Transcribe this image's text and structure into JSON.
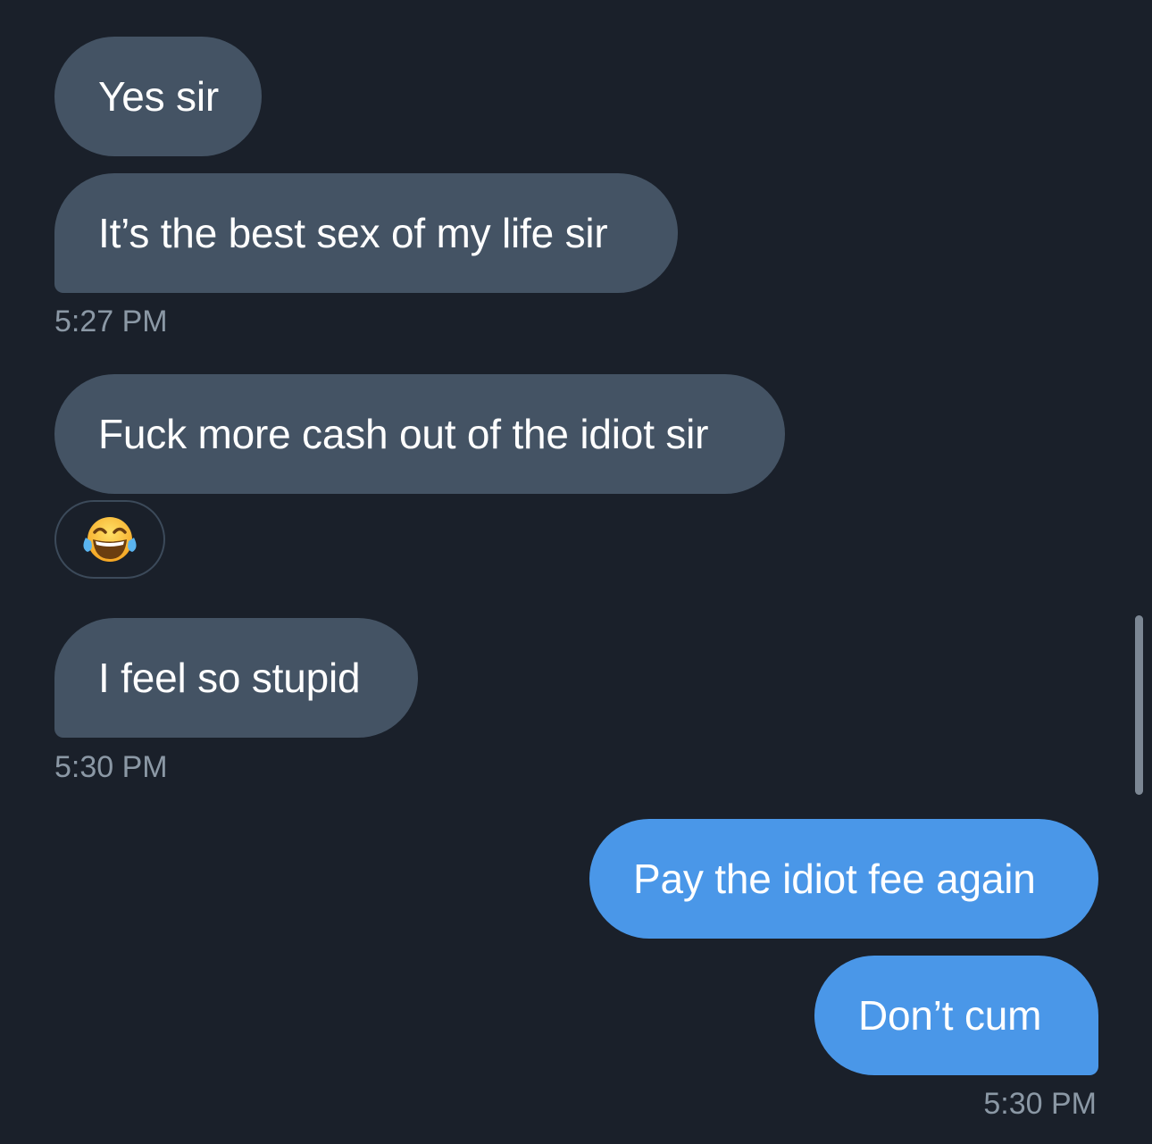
{
  "conversation": {
    "messages": [
      {
        "direction": "incoming",
        "text": "Yes sir"
      },
      {
        "direction": "incoming",
        "text": "It’s the best sex of my life sir"
      },
      {
        "direction": "incoming",
        "text": "Fuck more cash out of the idiot sir"
      },
      {
        "direction": "incoming",
        "text": "I feel so stupid"
      },
      {
        "direction": "outgoing",
        "text": "Pay the idiot fee again"
      },
      {
        "direction": "outgoing",
        "text": "Don’t cum"
      }
    ],
    "timestamps": [
      "5:27 PM",
      "5:30 PM",
      "5:30 PM"
    ],
    "reaction": {
      "icon": "face-with-tears-of-joy-emoji"
    }
  },
  "colors": {
    "background": "#1a202a",
    "incoming_bubble": "#445364",
    "outgoing_bubble": "#4a97e8",
    "timestamp": "#8b98a5"
  }
}
